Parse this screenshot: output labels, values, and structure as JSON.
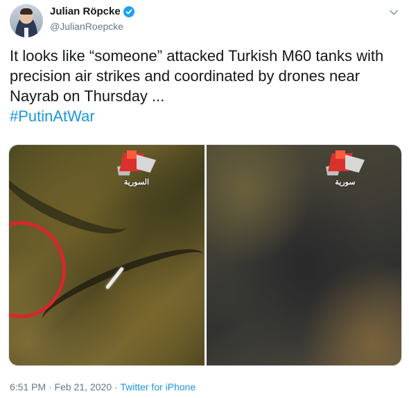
{
  "author": {
    "display_name": "Julian Röpcke",
    "handle": "@JulianRoepcke",
    "verified": true,
    "avatar_icon": "profile-photo"
  },
  "tweet": {
    "text": "It looks like “someone” attacked Turkish M60 tanks with precision air strikes and coordinated by drones near Nayrab on Thursday ...",
    "hashtag": "#PutinAtWar"
  },
  "media": {
    "photos": [
      {
        "channel_logo": "السورية"
      },
      {
        "channel_logo": "سورية"
      }
    ]
  },
  "meta": {
    "time": "6:51 PM",
    "separator": " · ",
    "date": "Feb 21, 2020",
    "source": "Twitter for iPhone"
  },
  "colors": {
    "link": "#1b95e0",
    "verified": "#1da1f2",
    "secondary_text": "#657786",
    "target_circle": "#d8262c"
  }
}
